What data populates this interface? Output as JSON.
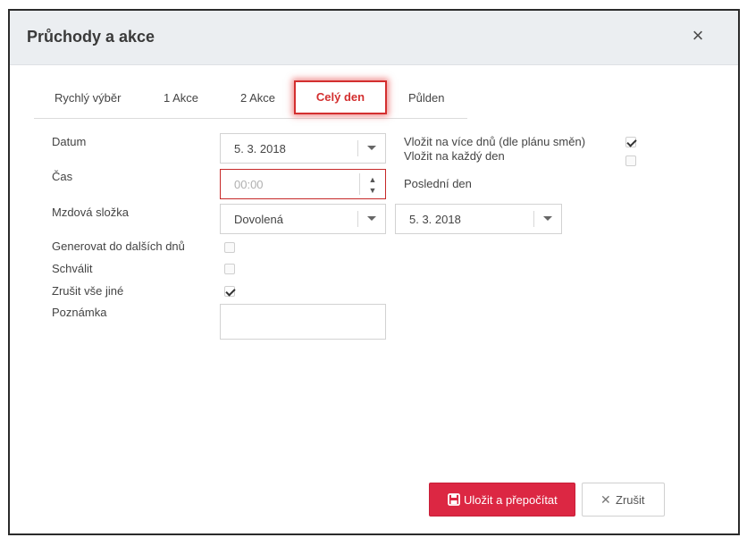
{
  "dialog": {
    "title": "Průchody a akce",
    "close_icon": "×"
  },
  "tabs": [
    "Rychlý výběr",
    "1 Akce",
    "2 Akce",
    "Celý den",
    "Půlden"
  ],
  "active_tab": "Celý den",
  "form": {
    "datum_label": "Datum",
    "datum_value": "5. 3. 2018",
    "cas_label": "Čas",
    "cas_placeholder": "00:00",
    "mzdova_label": "Mzdová složka",
    "mzdova_value": "Dovolená",
    "generovat_label": "Generovat do dalších dnů",
    "generovat_checked": false,
    "schvalit_label": "Schválit",
    "schvalit_checked": false,
    "zrusit_label": "Zrušit vše jiné",
    "zrusit_checked": true,
    "poznamka_label": "Poznámka",
    "vice_dnu_label": "Vložit na více dnů (dle plánu směn)",
    "vice_dnu_checked": true,
    "kazdy_den_label": "Vložit na každý den",
    "kazdy_den_checked": false,
    "posledni_den_label": "Poslední den",
    "posledni_den_value": "5. 3. 2018"
  },
  "buttons": {
    "save_label": "Uložit a přepočítat",
    "cancel_label": "Zrušit",
    "cancel_icon": "✕"
  },
  "colors": {
    "primary": "#dc2743",
    "highlight": "#d32f2f",
    "header_bg": "#ebeef1"
  },
  "icons": [
    "close-icon",
    "dropdown-arrow-icon",
    "spinner-icon",
    "save-icon",
    "cancel-x-icon",
    "checkmark-icon"
  ]
}
